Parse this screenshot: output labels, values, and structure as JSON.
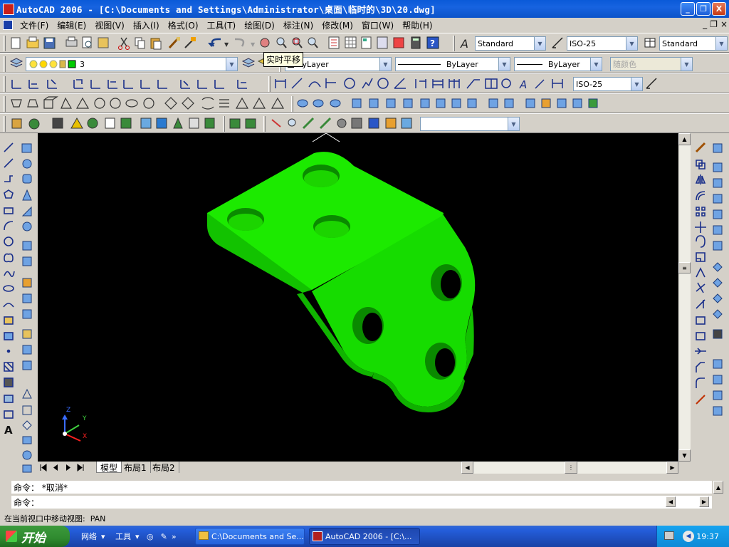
{
  "window": {
    "title": "AutoCAD 2006 - [C:\\Documents and Settings\\Administrator\\桌面\\临时的\\3D\\20.dwg]",
    "buttons": [
      "_",
      "❐",
      "X"
    ]
  },
  "menu": {
    "items": [
      "文件(F)",
      "编辑(E)",
      "视图(V)",
      "插入(I)",
      "格式(O)",
      "工具(T)",
      "绘图(D)",
      "标注(N)",
      "修改(M)",
      "窗口(W)",
      "帮助(H)"
    ],
    "doc_buttons": [
      "_",
      "❐",
      "×"
    ]
  },
  "toolbar": {
    "text_style": "Standard",
    "dim_style": "ISO-25",
    "table_style": "Standard",
    "layer": "3",
    "color": "ByLayer",
    "linetype": "ByLayer",
    "lineweight": "ByLayer",
    "plot_style": "随颜色",
    "dim_style2": "ISO-25",
    "tooltip": "实时平移",
    "named_views": ""
  },
  "canvas": {
    "background": "#000000",
    "model_color": "#19e600",
    "ucs_labels": [
      "Z",
      "Y",
      "X"
    ]
  },
  "tabs": [
    "模型",
    "布局1",
    "布局2"
  ],
  "command": {
    "history": "命令： *取消*",
    "prompt": "命令："
  },
  "status": {
    "text": "在当前视口中移动视图:  PAN"
  },
  "taskbar": {
    "start": "开始",
    "quick": [
      "网络",
      "工具"
    ],
    "tasks": [
      "C:\\Documents and Se...",
      "AutoCAD 2006 - [C:\\..."
    ],
    "clock": "19:37"
  }
}
